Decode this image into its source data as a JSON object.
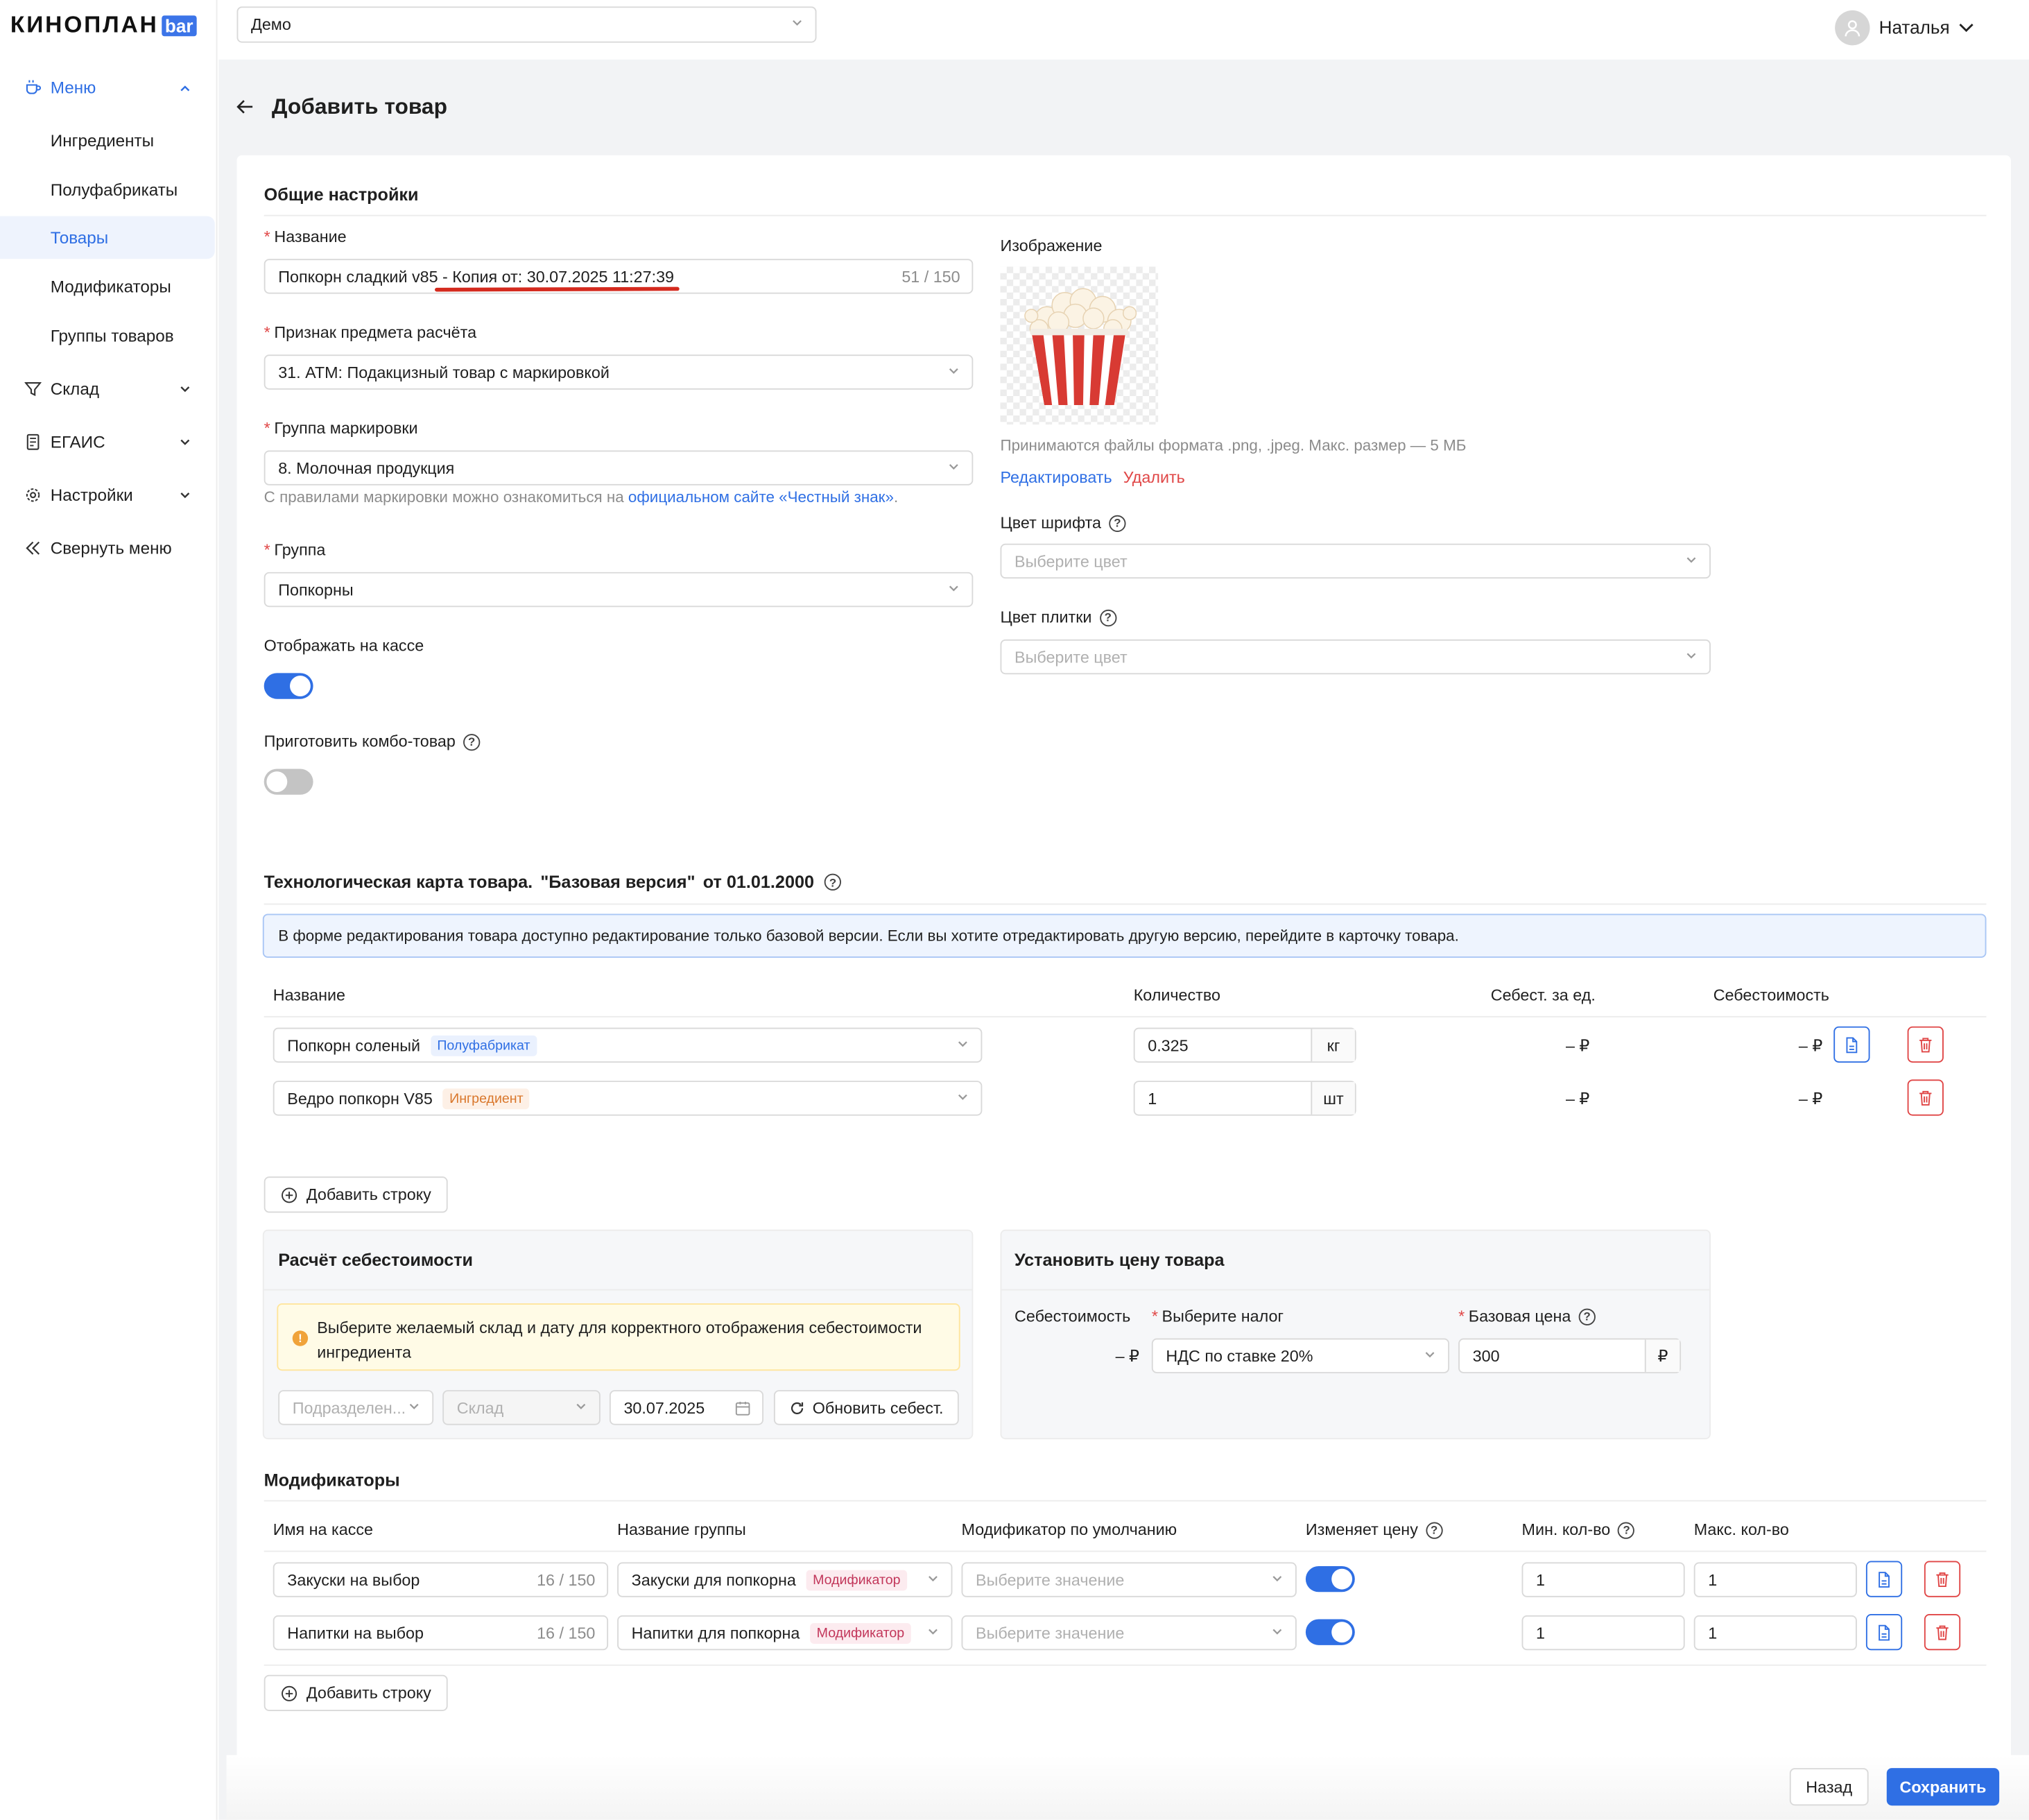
{
  "app": {
    "logo_main": "КИНОПЛАН",
    "logo_bar": "bar"
  },
  "topbar": {
    "cinema_select": "Демо",
    "user_name": "Наталья"
  },
  "sidebar": {
    "menu": "Меню",
    "sub_items": [
      "Ингредиенты",
      "Полуфабрикаты",
      "Товары",
      "Модификаторы",
      "Группы товаров"
    ],
    "warehouse": "Склад",
    "egais": "ЕГАИС",
    "settings": "Настройки",
    "collapse": "Свернуть меню"
  },
  "page": {
    "title": "Добавить товар"
  },
  "general": {
    "title": "Общие настройки",
    "name_label": "Название",
    "name_value": "Попкорн сладкий v85 - Копия от: 30.07.2025 11:27:39",
    "name_counter": "51 / 150",
    "payment_label": "Признак предмета расчёта",
    "payment_value": "31. АТМ: Подакцизный товар с маркировкой",
    "marking_label": "Группа маркировки",
    "marking_value": "8. Молочная продукция",
    "marking_hint": "С правилами маркировки можно ознакомиться на ",
    "marking_link": "официальном сайте «Честный знак»",
    "marking_hint_end": ".",
    "group_label": "Группа",
    "group_value": "Попкорны",
    "show_on_pos_label": "Отображать на кассе",
    "show_on_pos": true,
    "combo_label": "Приготовить комбо-товар",
    "combo": false,
    "image_label": "Изображение",
    "image_hint": "Принимаются файлы формата .png, .jpeg. Макс. размер — 5 МБ",
    "image_edit": "Редактировать",
    "image_delete": "Удалить",
    "font_color_label": "Цвет шрифта",
    "font_color_placeholder": "Выберите цвет",
    "tile_color_label": "Цвет плитки",
    "tile_color_placeholder": "Выберите цвет"
  },
  "techcard": {
    "title_a": "Технологическая карта товара.",
    "title_b": "\"Базовая версия\"",
    "title_c": "от 01.01.2000",
    "info": "В форме редактирования товара доступно редактирование только базовой версии. Если вы хотите отредактировать другую версию, перейдите в карточку товара.",
    "headers": [
      "Название",
      "Количество",
      "Себест. за ед.",
      "Себестоимость"
    ],
    "rows": [
      {
        "name": "Попкорн соленый",
        "tag": "Полуфабрикат",
        "qty": "0.325",
        "unit": "кг",
        "unit_cost": "– ₽",
        "cost": "– ₽"
      },
      {
        "name": "Ведро попкорн V85",
        "tag": "Ингредиент",
        "qty": "1",
        "unit": "шт",
        "unit_cost": "– ₽",
        "cost": "– ₽"
      }
    ],
    "add_row": "Добавить строку"
  },
  "cost_calc": {
    "title": "Расчёт себестоимости",
    "warning": "Выберите желаемый склад и дату для корректного отображения себестоимости ингредиента",
    "division_placeholder": "Подразделен...",
    "warehouse_placeholder": "Склад",
    "date": "30.07.2025",
    "refresh": "Обновить себест."
  },
  "price": {
    "title": "Установить цену товара",
    "cost_label": "Себестоимость",
    "cost_value": "– ₽",
    "tax_label": "Выберите налог",
    "tax_value": "НДС по ставке 20%",
    "base_price_label": "Базовая цена",
    "base_price_value": "300",
    "currency": "₽"
  },
  "modifiers": {
    "title": "Модификаторы",
    "headers": [
      "Имя на кассе",
      "Название группы",
      "Модификатор по умолчанию",
      "Изменяет цену",
      "Мин. кол-во",
      "Макс. кол-во"
    ],
    "rows": [
      {
        "pos_name": "Закуски на выбор",
        "counter": "16 / 150",
        "group": "Закуски для попкорна",
        "tag": "Модификатор",
        "default_placeholder": "Выберите значение",
        "changes_price": true,
        "min": "1",
        "max": "1"
      },
      {
        "pos_name": "Напитки на выбор",
        "counter": "16 / 150",
        "group": "Напитки для попкорна",
        "tag": "Модификатор",
        "default_placeholder": "Выберите значение",
        "changes_price": true,
        "min": "1",
        "max": "1"
      }
    ],
    "add_row": "Добавить строку"
  },
  "footer": {
    "back": "Назад",
    "save": "Сохранить"
  },
  "colors": {
    "accent": "#2f6fe4",
    "danger": "#e04646",
    "annotation": "#d42a1e"
  }
}
